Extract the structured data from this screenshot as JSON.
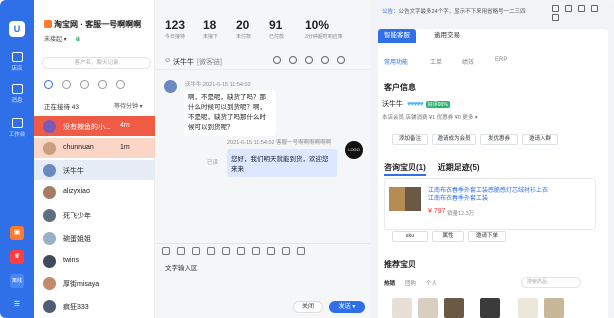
{
  "rail": {
    "logo": "U",
    "items": [
      "店店",
      "消息",
      "工作台"
    ],
    "badge": "离线"
  },
  "shop": {
    "name": "淘宝网 · 客服一号啊啊啊",
    "status": "未接起",
    "wave": "·ılıılı"
  },
  "search": {
    "placeholder": "客户名，聊天记录"
  },
  "list": {
    "serving": "正在接待 43",
    "order": "等待分钟"
  },
  "rows": [
    {
      "name": "没有辣鱼的小...",
      "time": "4m"
    },
    {
      "name": "chunnuan",
      "time": "1m"
    },
    {
      "name": "沃牛牛",
      "time": ""
    },
    {
      "name": "alizyxiao",
      "time": ""
    },
    {
      "name": "死飞少年",
      "time": ""
    },
    {
      "name": "碗蛋姐姐",
      "time": ""
    },
    {
      "name": "twins",
      "time": ""
    },
    {
      "name": "厚街misaya",
      "time": ""
    },
    {
      "name": "疯狂333",
      "time": ""
    }
  ],
  "stats": [
    {
      "v": "123",
      "l": "今日接待"
    },
    {
      "v": "18",
      "l": "未接下"
    },
    {
      "v": "20",
      "l": "未付款"
    },
    {
      "v": "91",
      "l": "已付款"
    },
    {
      "v": "10%",
      "l": "3分钟超时响应率"
    }
  ],
  "chat": {
    "who": "沃牛牛",
    "tag": "[微客链]",
    "m1": {
      "meta": "沃牛牛    2021-6-15 11:54:02",
      "text": "啊，不是呢，缺货了吗？那什么时候可以到货呢？啊，不是呢，缺货了吗那什么时候可以到货呢？"
    },
    "m2": {
      "meta": "2021-6-15 11:54:02  客服一号啊啊啊啊啊啊",
      "read": "已读",
      "text": "您好，我们明天就能到货，欢迎您来来",
      "brand": "LOGO"
    },
    "input": "文字输入区",
    "close": "关闭",
    "send": "发送 ▾"
  },
  "right": {
    "notice_label": "公告：",
    "notice": "公告文字最多24个字，显示不下来用省略号一二三四",
    "tabs": [
      "智能客服",
      "逾用交易"
    ],
    "subtabs": [
      "常用功能",
      "工单",
      "绩效",
      "ERP"
    ],
    "cust_title": "客户信息",
    "cust_name": "沃牛牛",
    "hearts": "♥♥♥♥♥",
    "good": "好评90%",
    "cust_detail": "本店会员    店铺消费 ¥1    优惠券 ¥0    更多 ▾",
    "btns": [
      "添加备注",
      "邀请成为会员",
      "发优惠券",
      "邀请入群"
    ],
    "ptab1": "咨询宝贝(1)",
    "ptab2": "近期足迹(5)",
    "prod": {
      "title": "江南布衣春季外套工装感脆感灯芯绒衬衫上衣江南布衣春季外套工装",
      "price": "¥ 797",
      "sold": "销量12.3万"
    },
    "ptags": [
      "sku",
      "属性",
      "邀请下单"
    ],
    "rec_title": "推荐宝贝",
    "rectabs": [
      "热销",
      "团购",
      "个人"
    ],
    "rsearch": "搜索商品"
  }
}
